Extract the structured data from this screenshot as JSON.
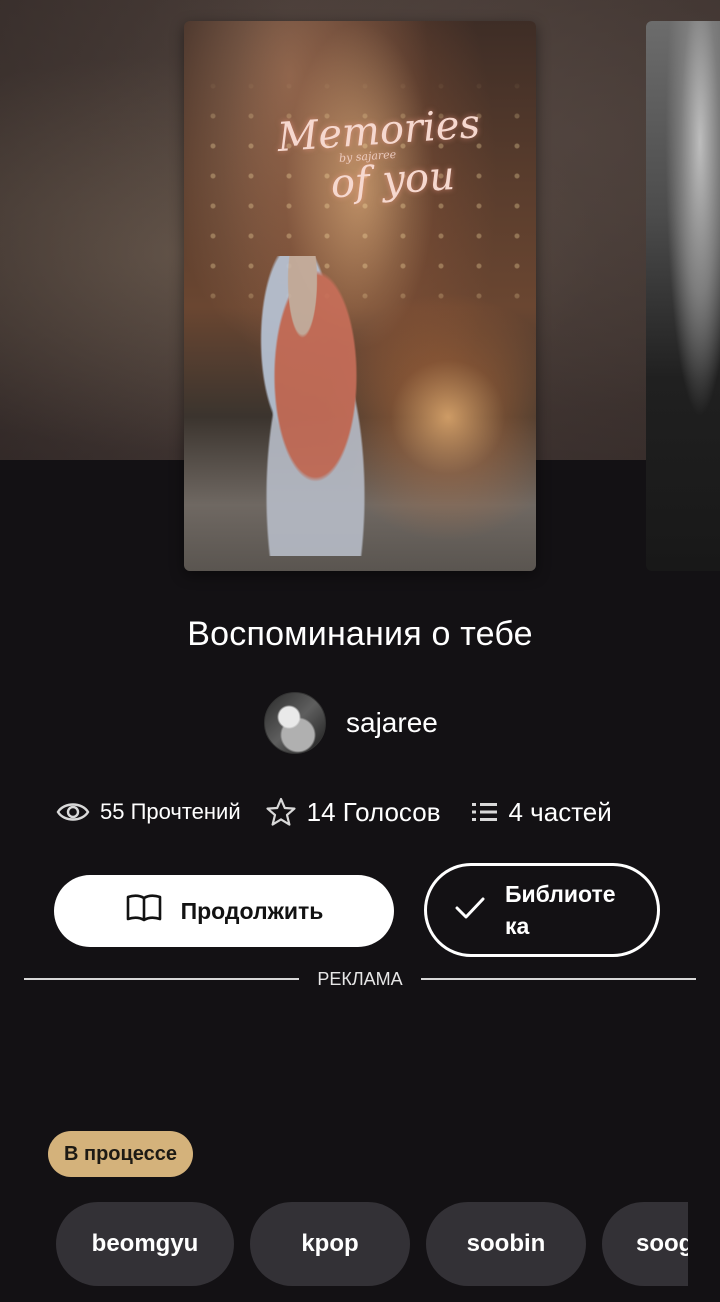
{
  "book": {
    "cover_text": {
      "line1": "Memories",
      "byline": "by sajaree",
      "line2": "of you"
    },
    "title": "Воспоминания о тебе",
    "author": "sajaree"
  },
  "stats": {
    "reads": "55 Прочтений",
    "votes": "14 Голосов",
    "parts": "4 частей"
  },
  "actions": {
    "continue_label": "Продолжить",
    "library_label": "Библиоте ка"
  },
  "ad_label": "РЕКЛАМА",
  "status_badge": "В процессе",
  "tags": [
    "beomgyu",
    "kpop",
    "soobin",
    "soog"
  ],
  "icons": {
    "reads": "eye-icon",
    "votes": "star-icon",
    "parts": "list-icon",
    "continue": "book-icon",
    "library": "check-icon"
  },
  "colors": {
    "background": "#131114",
    "badge": "#d4b27b",
    "tag_bg": "#333136",
    "button_primary": "#ffffff"
  }
}
